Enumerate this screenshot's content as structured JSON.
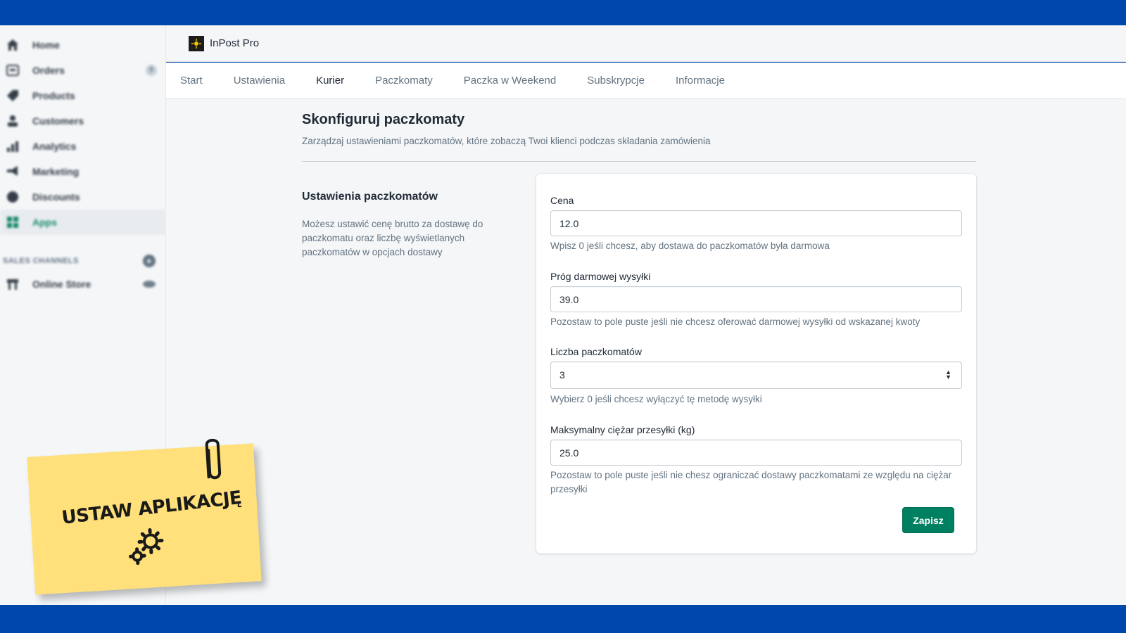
{
  "sidebar": {
    "items": [
      {
        "label": "Home",
        "icon": "home-icon"
      },
      {
        "label": "Orders",
        "icon": "orders-icon",
        "badge": "9"
      },
      {
        "label": "Products",
        "icon": "tag-icon"
      },
      {
        "label": "Customers",
        "icon": "user-icon"
      },
      {
        "label": "Analytics",
        "icon": "bar-chart-icon"
      },
      {
        "label": "Marketing",
        "icon": "megaphone-icon"
      },
      {
        "label": "Discounts",
        "icon": "discount-icon"
      },
      {
        "label": "Apps",
        "icon": "apps-icon",
        "active": true
      }
    ],
    "channels_heading": "SALES CHANNELS",
    "channels": [
      {
        "label": "Online Store",
        "icon": "store-icon"
      }
    ]
  },
  "app": {
    "title": "InPost Pro"
  },
  "tabs": [
    "Start",
    "Ustawienia",
    "Kurier",
    "Paczkomaty",
    "Paczka w Weekend",
    "Subskrypcje",
    "Informacje"
  ],
  "active_tab": "Kurier",
  "page": {
    "title": "Skonfiguruj paczkomaty",
    "subtitle": "Zarządzaj ustawieniami paczkomatów, które zobaczą Twoi klienci podczas składania zamówienia"
  },
  "section": {
    "title": "Ustawienia paczkomatów",
    "description": "Możesz ustawić cenę brutto za dostawę do paczkomatu oraz liczbę wyświetlanych paczkomatów w opcjach dostawy"
  },
  "form": {
    "price": {
      "label": "Cena",
      "value": "12.0",
      "help": "Wpisz 0 jeśli chcesz, aby dostawa do paczkomatów była darmowa"
    },
    "free_threshold": {
      "label": "Próg darmowej wysyłki",
      "value": "39.0",
      "help": "Pozostaw to pole puste jeśli nie chcesz oferować darmowej wysyłki od wskazanej kwoty"
    },
    "count": {
      "label": "Liczba paczkomatów",
      "value": "3",
      "help": "Wybierz 0 jeśli chcesz wyłączyć tę metodę wysyłki"
    },
    "max_weight": {
      "label": "Maksymalny ciężar przesyłki (kg)",
      "value": "25.0",
      "help": "Pozostaw to pole puste jeśli nie chesz ograniczać dostawy paczkomatami ze względu na ciężar przesyłki"
    },
    "save_label": "Zapisz"
  },
  "sticky_note": {
    "text": "USTAW APLIKACJĘ"
  },
  "colors": {
    "frame_blue": "#0047ab",
    "primary_green": "#008060",
    "note_yellow": "#ffe07a"
  }
}
